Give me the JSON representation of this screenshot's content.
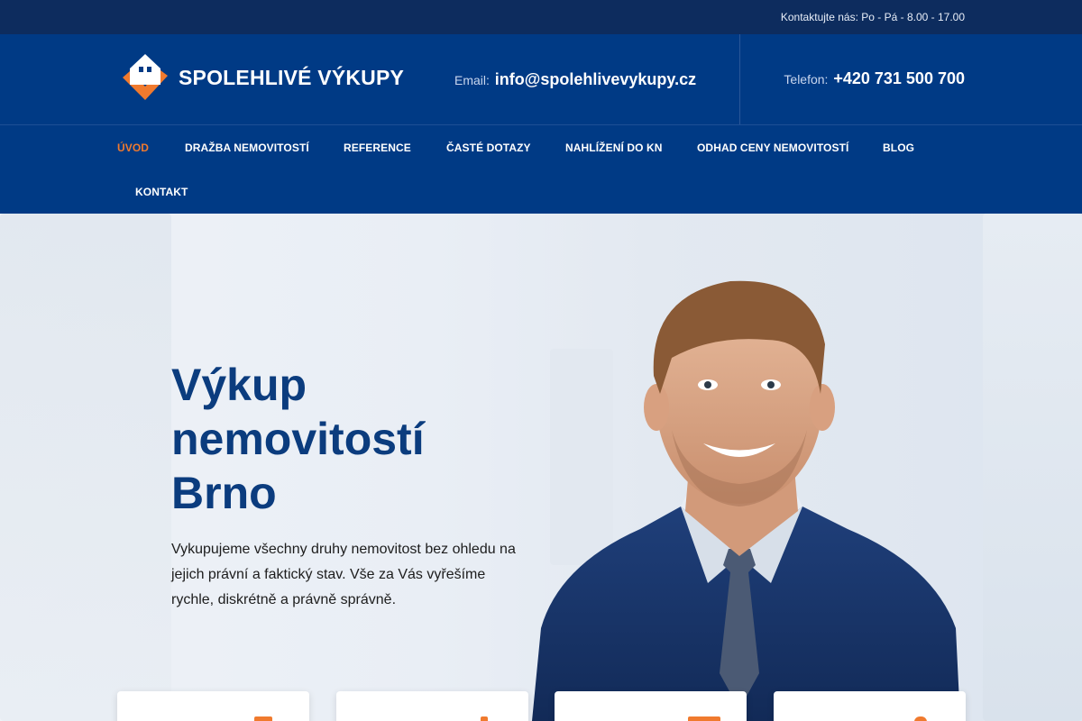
{
  "topbar": {
    "contact": "Kontaktujte nás: Po - Pá - 8.00 - 17.00"
  },
  "header": {
    "brand": "SPOLEHLIVÉ VÝKUPY",
    "email_label": "Email:",
    "email": "info@spolehlivevykupy.cz",
    "phone_label": "Telefon:",
    "phone": "+420 731 500 700"
  },
  "nav": {
    "items": [
      {
        "label": "ÚVOD",
        "active": true
      },
      {
        "label": "DRAŽBA NEMOVITOSTÍ"
      },
      {
        "label": "REFERENCE"
      },
      {
        "label": "ČASTÉ DOTAZY"
      },
      {
        "label": "NAHLÍŽENÍ DO KN"
      },
      {
        "label": "ODHAD CENY NEMOVITOSTÍ"
      },
      {
        "label": "BLOG"
      },
      {
        "label": "KONTAKT"
      }
    ]
  },
  "hero": {
    "title_lines": [
      "Výkup",
      "nemovitostí",
      "Brno"
    ],
    "description": "Vykupujeme všechny druhy nemovitost bez ohledu na jejich právní a faktický stav. Vše za Vás vyřešíme rychle, diskrétně a právně správně."
  },
  "colors": {
    "accent": "#f07a2e",
    "primary": "#003a85",
    "topbar": "#0d2c5e",
    "title": "#0b3c7e"
  }
}
